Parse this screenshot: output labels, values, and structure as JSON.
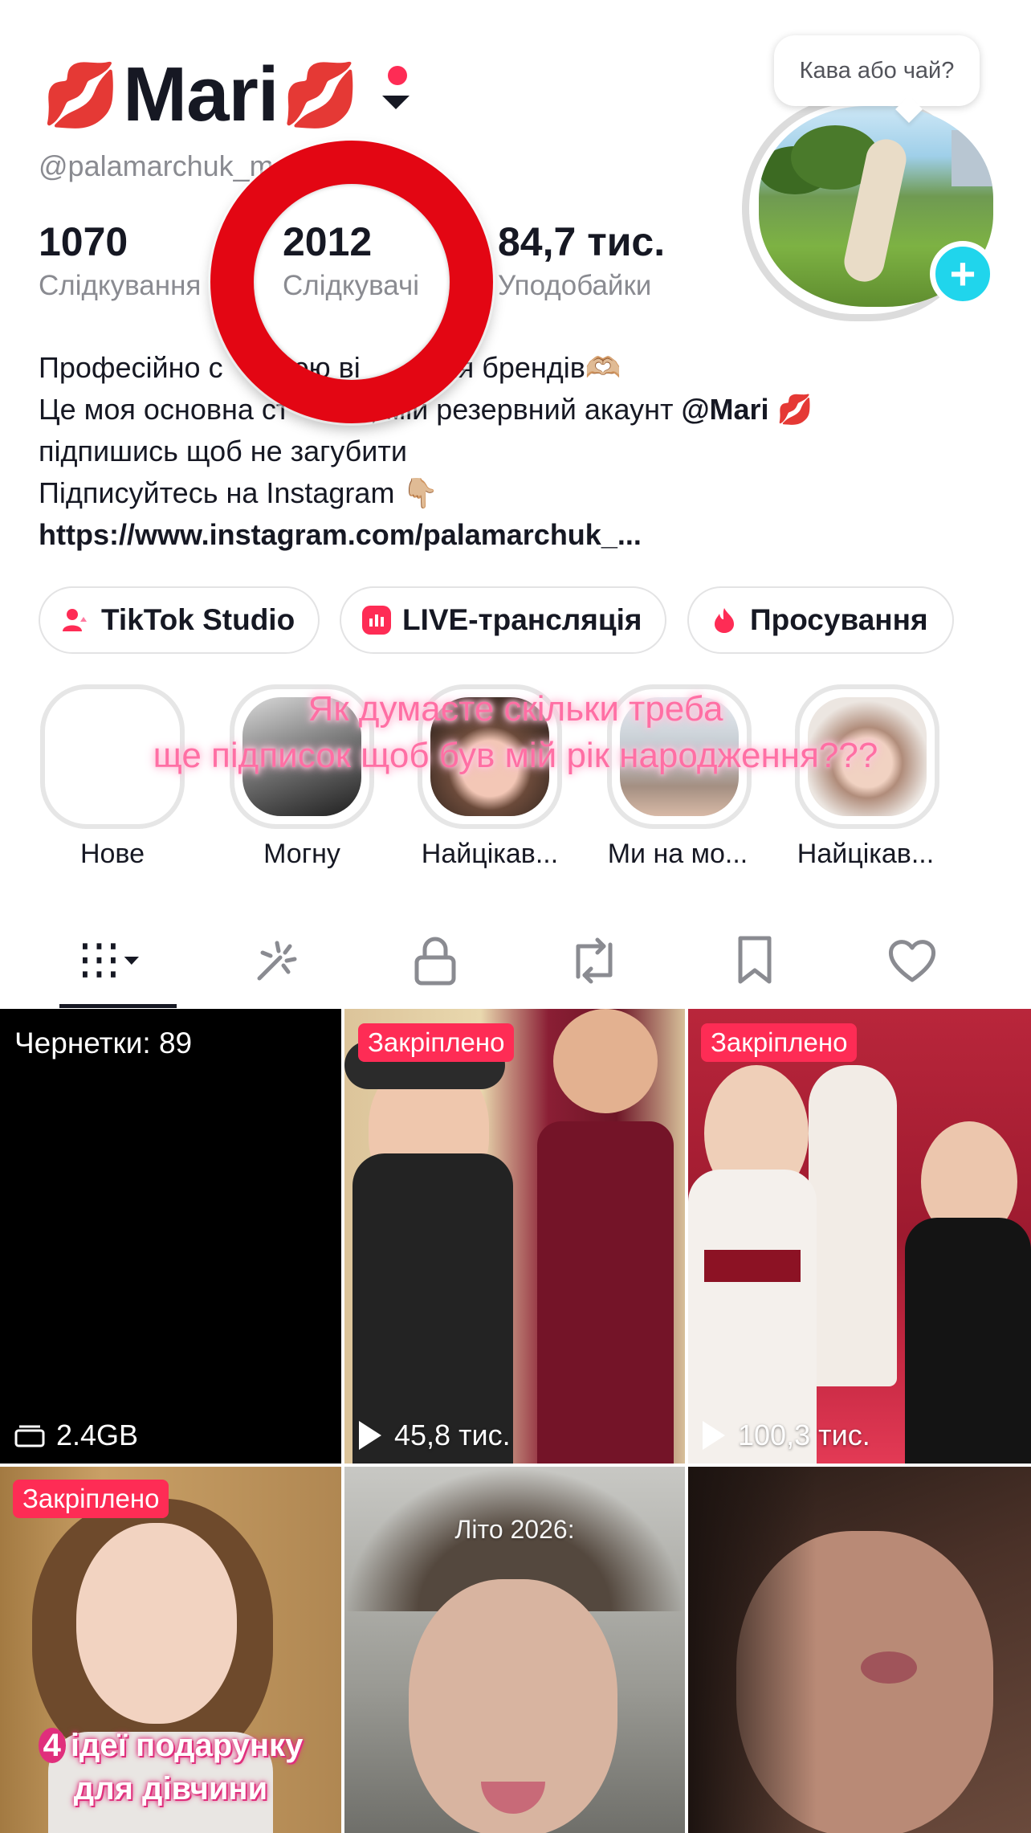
{
  "profile": {
    "name": "Mari",
    "name_emoji": "💋",
    "handle": "@palamarchuk_m",
    "bubble_text": "Кава або чай?",
    "plus_icon": "+"
  },
  "stats": [
    {
      "value": "1070",
      "label": "Слідкування"
    },
    {
      "value": "2012",
      "label": "Слідкувачі"
    },
    {
      "value": "84,7 тис.",
      "label": "Уподобайки"
    }
  ],
  "bio": {
    "line1": "Професійно с        юю ві        для брендів🫶🏼",
    "line2_start": "Це моя основна ст        а, мій резервний акаунт ",
    "line2_mention": "@Mari",
    "line2_end": " 💋",
    "line3": "підпишись щоб не загубити",
    "line4": "Підписуйтесь на Instagram 👇🏼",
    "link": "https://www.instagram.com/palamarchuk_..."
  },
  "actions": [
    {
      "label": "TikTok Studio",
      "icon": "tiktok-studio-icon"
    },
    {
      "label": "LIVE-трансляція",
      "icon": "live-icon"
    },
    {
      "label": "Просування",
      "icon": "promote-flame-icon"
    }
  ],
  "overlay": {
    "line1": "Як думаєте скільки треба",
    "line2": "ще підписок щоб був мій рік народження???"
  },
  "highlights": [
    {
      "label": "Нове"
    },
    {
      "label": "Могну"
    },
    {
      "label": "Найцікав..."
    },
    {
      "label": "Ми на мо..."
    },
    {
      "label": "Найцікав..."
    }
  ],
  "tabs": [
    {
      "name": "videos-grid-icon"
    },
    {
      "name": "effects-wand-icon"
    },
    {
      "name": "private-lock-icon"
    },
    {
      "name": "repost-icon"
    },
    {
      "name": "favorites-bookmark-icon"
    },
    {
      "name": "liked-heart-icon"
    }
  ],
  "grid": {
    "drafts_label": "Чернетки: 89",
    "drafts_size": "2.4GB",
    "pinned_label": "Закріплено",
    "video2_views": "45,8 тис.",
    "video3_views": "100,3 тис.",
    "video5_caption": "Літо 2026:",
    "video4_caption_num": "4",
    "video4_caption_line1": "ідеї подарунку",
    "video4_caption_line2": "для дівчини"
  },
  "colors": {
    "accent": "#fe2c55",
    "plus": "#20d5ec",
    "annotation_ring": "#e30613",
    "overlay_text": "#ff6fa4"
  }
}
